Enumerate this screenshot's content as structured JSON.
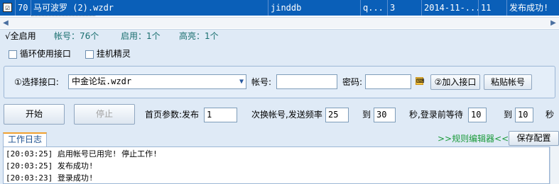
{
  "table": {
    "row": {
      "checked": "☑",
      "index": "70",
      "title": "马可波罗 (2).wzdr",
      "account": "jinddb",
      "col4": "q...",
      "count": "3",
      "date": "2014-11-...",
      "col7": "11",
      "status": "发布成功!"
    }
  },
  "summary": {
    "select_all": "√全启用",
    "accounts": "帐号：76个",
    "enabled": "启用：1个",
    "highlight": "高亮：1个"
  },
  "options": {
    "loop_label": "循环使用接口",
    "sprite_label": "挂机精灵"
  },
  "interface": {
    "select_label": "①选择接口:",
    "select_value": "中金论坛.wzdr",
    "account_label": "帐号:",
    "account_value": "",
    "password_label": "密码:",
    "password_value": "",
    "add_button": "②加入接口",
    "paste_button": "粘贴帐号"
  },
  "controls": {
    "start_button": "开始",
    "stop_button": "停止",
    "home_params_label": "首页参数:发布",
    "home_params_value": "1",
    "rate_label": "次换帐号,发送频率",
    "rate_value": "25",
    "to_label_1": "到",
    "rate_to_value": "30",
    "wait_label": "秒,登录前等待",
    "wait_from_value": "10",
    "to_label_2": "到",
    "wait_to_value": "10",
    "seconds_label": "秒"
  },
  "log": {
    "tab_label": "工作日志",
    "rules_link": ">>规则编辑器<<",
    "save_button": "保存配置",
    "lines": [
      "[20:03:25] 启用帐号已用完! 停止工作!",
      "[20:03:25] 发布成功!",
      "[20:03:23] 登录成功!"
    ]
  }
}
